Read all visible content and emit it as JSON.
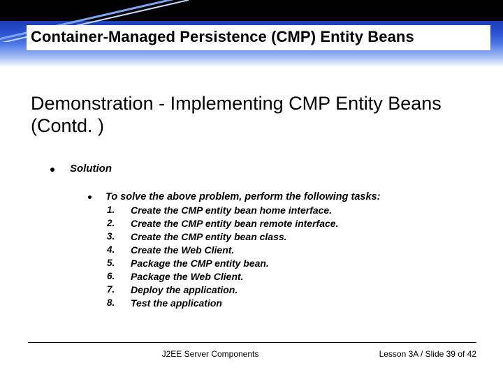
{
  "header": {
    "title": "Container-Managed Persistence (CMP) Entity Beans"
  },
  "main": {
    "title": "Demonstration - Implementing CMP Entity Beans (Contd. )",
    "l1_label": "Solution",
    "l2_intro": "To solve the above problem, perform the following tasks:",
    "tasks": [
      {
        "n": "1.",
        "t": "Create the CMP entity bean home interface."
      },
      {
        "n": "2.",
        "t": "Create the CMP entity bean remote interface."
      },
      {
        "n": "3.",
        "t": "Create the CMP entity bean class."
      },
      {
        "n": "4.",
        "t": "Create the Web Client."
      },
      {
        "n": "5.",
        "t": "Package the CMP entity bean."
      },
      {
        "n": "6.",
        "t": "Package the Web Client."
      },
      {
        "n": "7.",
        "t": "Deploy the application."
      },
      {
        "n": "8.",
        "t": "Test the application"
      }
    ]
  },
  "footer": {
    "left": "J2EE Server Components",
    "right": "Lesson 3A / Slide 39 of 42"
  }
}
